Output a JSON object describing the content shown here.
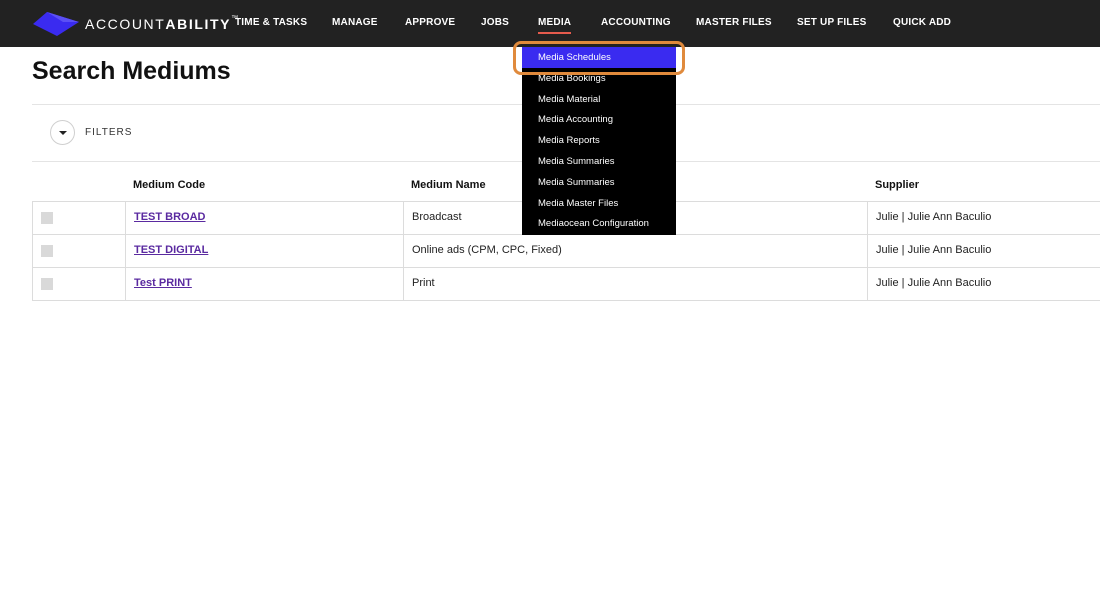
{
  "header": {
    "brand_light": "ACCOUNT",
    "brand_bold": "ABILITY",
    "brand_mark": "™",
    "nav": [
      {
        "label": "TIME & TASKS"
      },
      {
        "label": "MANAGE"
      },
      {
        "label": "APPROVE"
      },
      {
        "label": "JOBS"
      },
      {
        "label": "MEDIA"
      },
      {
        "label": "ACCOUNTING"
      },
      {
        "label": "MASTER FILES"
      },
      {
        "label": "SET UP FILES"
      },
      {
        "label": "QUICK ADD"
      }
    ],
    "active_nav": "MEDIA"
  },
  "page": {
    "title": "Search Mediums",
    "filters_label": "FILTERS"
  },
  "table": {
    "columns": [
      "Medium Code",
      "Medium Name",
      "Supplier"
    ],
    "rows": [
      {
        "code": "TEST BROAD",
        "name": "Broadcast",
        "supplier": "Julie | Julie Ann Baculio"
      },
      {
        "code": "TEST DIGITAL",
        "name": "Online ads (CPM, CPC, Fixed)",
        "supplier": "Julie | Julie Ann Baculio"
      },
      {
        "code": "Test PRINT",
        "name": "Print",
        "supplier": "Julie | Julie Ann Baculio"
      }
    ]
  },
  "media_menu": {
    "items": [
      {
        "label": "Media Schedules"
      },
      {
        "label": "Media Bookings"
      },
      {
        "label": "Media Material"
      },
      {
        "label": "Media Accounting"
      },
      {
        "label": "Media Reports"
      },
      {
        "label": "Media Summaries"
      },
      {
        "label": "Media Summaries"
      },
      {
        "label": "Media Master Files"
      },
      {
        "label": "Mediaocean Configuration"
      }
    ],
    "selected": "Media Schedules"
  },
  "colors": {
    "topbar": "#222222",
    "logo": "#3a2bf0",
    "menu_selected": "#3a2bf0",
    "highlight": "#e08a3c",
    "link": "#5a2aa0"
  }
}
